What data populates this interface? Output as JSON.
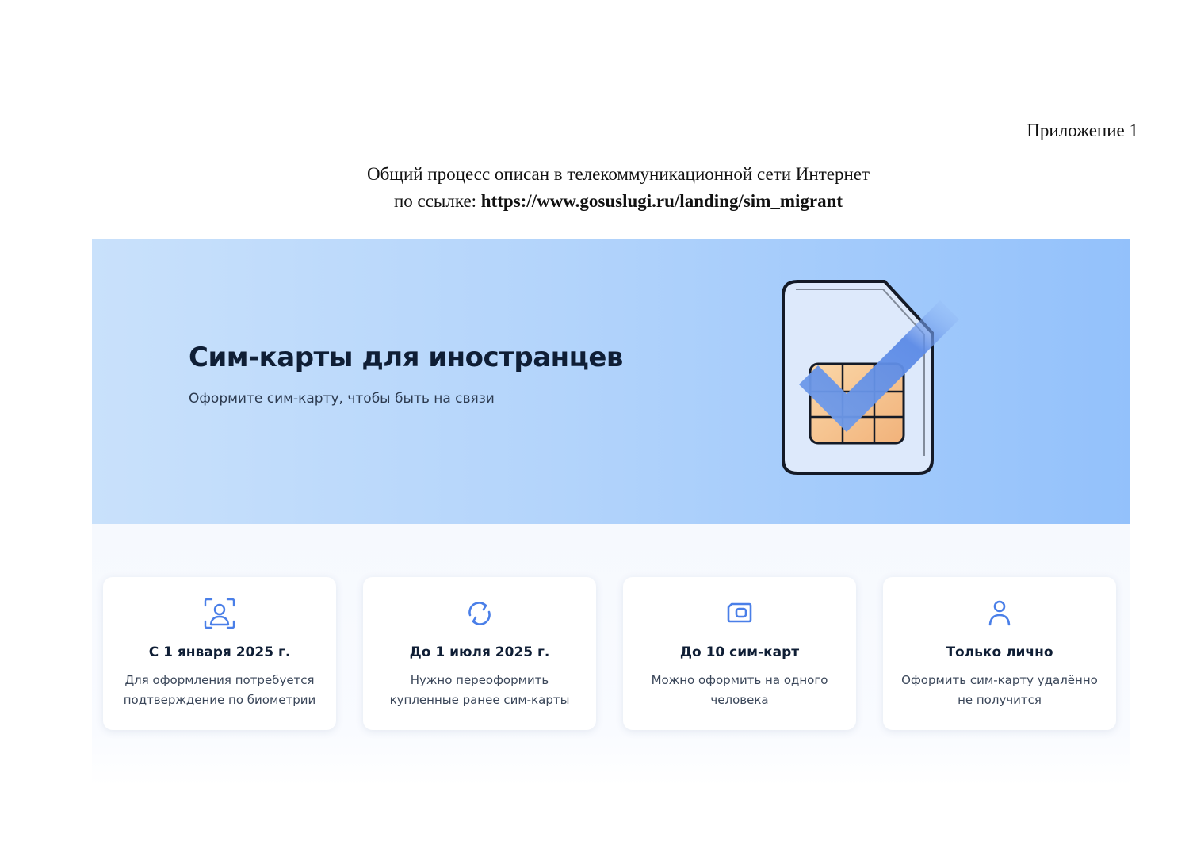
{
  "document": {
    "appendix": "Приложение 1",
    "intro_line1": "Общий процесс описан в телекоммуникационной сети Интернет",
    "intro_prefix": "по ссылке: ",
    "intro_url": "https://www.gosuslugi.ru/landing/sim_migrant"
  },
  "hero": {
    "title": "Сим-карты для иностранцев",
    "subtitle": "Оформите сим-карту, чтобы быть на связи"
  },
  "features": [
    {
      "icon": "face-scan-icon",
      "title": "С 1 января 2025 г.",
      "text": "Для оформления потребуется подтверждение по биометрии"
    },
    {
      "icon": "refresh-icon",
      "title": "До 1 июля 2025 г.",
      "text": "Нужно переоформить купленные ранее сим-карты"
    },
    {
      "icon": "sim-card-icon",
      "title": "До 10 сим-карт",
      "text": "Можно оформить на одного человека"
    },
    {
      "icon": "person-icon",
      "title": "Только лично",
      "text": "Оформить сим-карту удалённо не получится"
    }
  ],
  "colors": {
    "accent": "#4a7fe8",
    "hero_gradient_start": "#c9e1fb",
    "hero_gradient_end": "#93c1fb"
  }
}
